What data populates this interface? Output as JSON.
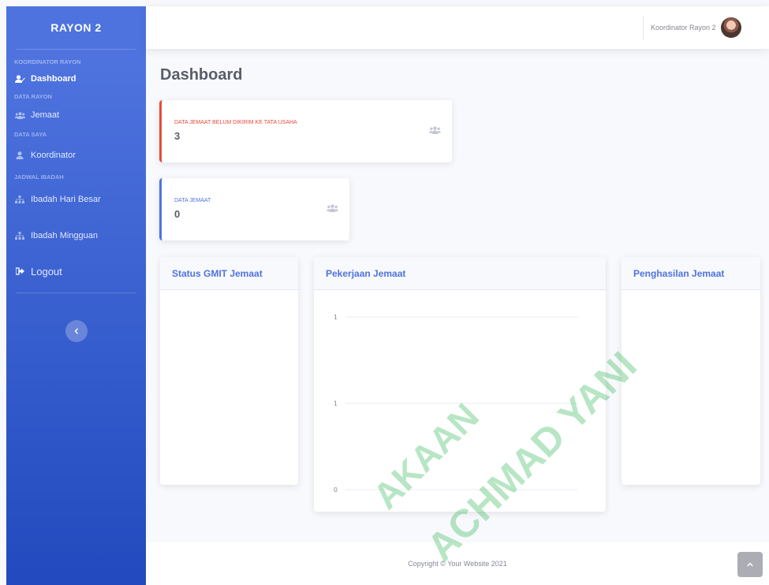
{
  "sidebar": {
    "brand": "RAYON 2",
    "sections": [
      {
        "heading": "KOORDINATOR RAYON",
        "items": [
          {
            "label": "Dashboard",
            "icon": "user-edit-icon",
            "active": true
          }
        ]
      },
      {
        "heading": "DATA RAYON",
        "items": [
          {
            "label": "Jemaat",
            "icon": "users-icon"
          }
        ]
      },
      {
        "heading": "DATA SAYA",
        "items": [
          {
            "label": "Koordinator",
            "icon": "user-icon"
          }
        ]
      },
      {
        "heading": "JADWAL IBADAH",
        "items": [
          {
            "label": "Ibadah Hari Besar",
            "icon": "sitemap-icon"
          },
          {
            "label": "Ibadah Mingguan",
            "icon": "sitemap-icon"
          }
        ]
      }
    ],
    "logout": "Logout",
    "toggle_icon": "chevron-left-icon"
  },
  "topbar": {
    "user_name": "Koordinator Rayon 2"
  },
  "page": {
    "title": "Dashboard"
  },
  "stats": [
    {
      "label": "DATA JEMAAT BELUM DIKIRIM KE TATA USAHA",
      "value": "3",
      "color": "#e74a3b",
      "icon": "users-icon"
    },
    {
      "label": "DATA JEMAAT",
      "value": "0",
      "color": "#4e73df",
      "icon": "users-icon"
    }
  ],
  "cards": {
    "status": "Status GMIT Jemaat",
    "pekerjaan": "Pekerjaan Jemaat",
    "penghasilan": "Penghasilan Jemaat"
  },
  "chart_data": {
    "type": "bar",
    "title": "Pekerjaan Jemaat",
    "categories": [],
    "series": [],
    "ytick_labels": [
      "1",
      "1",
      "0"
    ],
    "grid": true
  },
  "footer": {
    "copyright": "Copyright © Your Website 2021"
  },
  "watermark": {
    "lines": [
      "AKAAN",
      "ACHMAD YANI"
    ]
  }
}
